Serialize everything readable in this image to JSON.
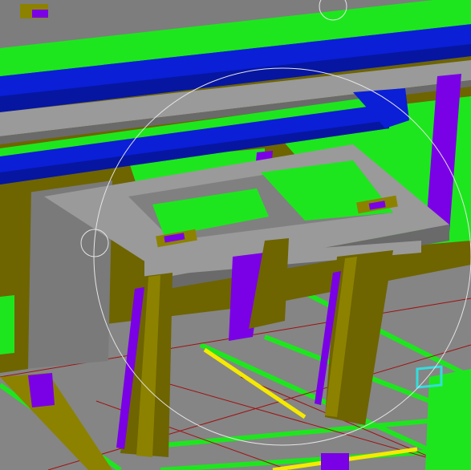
{
  "viewport": {
    "colors": {
      "background": "#808080",
      "floor_light": "#8a8a8a",
      "beam_blue": "#0a1fd6",
      "beam_blue_dark": "#0616a0",
      "green": "#1ee61e",
      "green_dark": "#0fb40f",
      "olive": "#6e6400",
      "olive_light": "#8c8200",
      "olive_dark": "#504800",
      "purple": "#7a00e6",
      "purple_dark": "#5a00b0",
      "yellow": "#f5ea00",
      "cyan": "#33dddd",
      "gray_light": "#9a9a9a",
      "gray_mid": "#7d7d7d",
      "gray_dark": "#6a6a6a",
      "red_line": "#a01010",
      "orbit": "#e6e6e6"
    },
    "icons": [
      "orbit-circle-icon",
      "orbit-handle-left-icon",
      "orbit-handle-top-icon"
    ]
  }
}
